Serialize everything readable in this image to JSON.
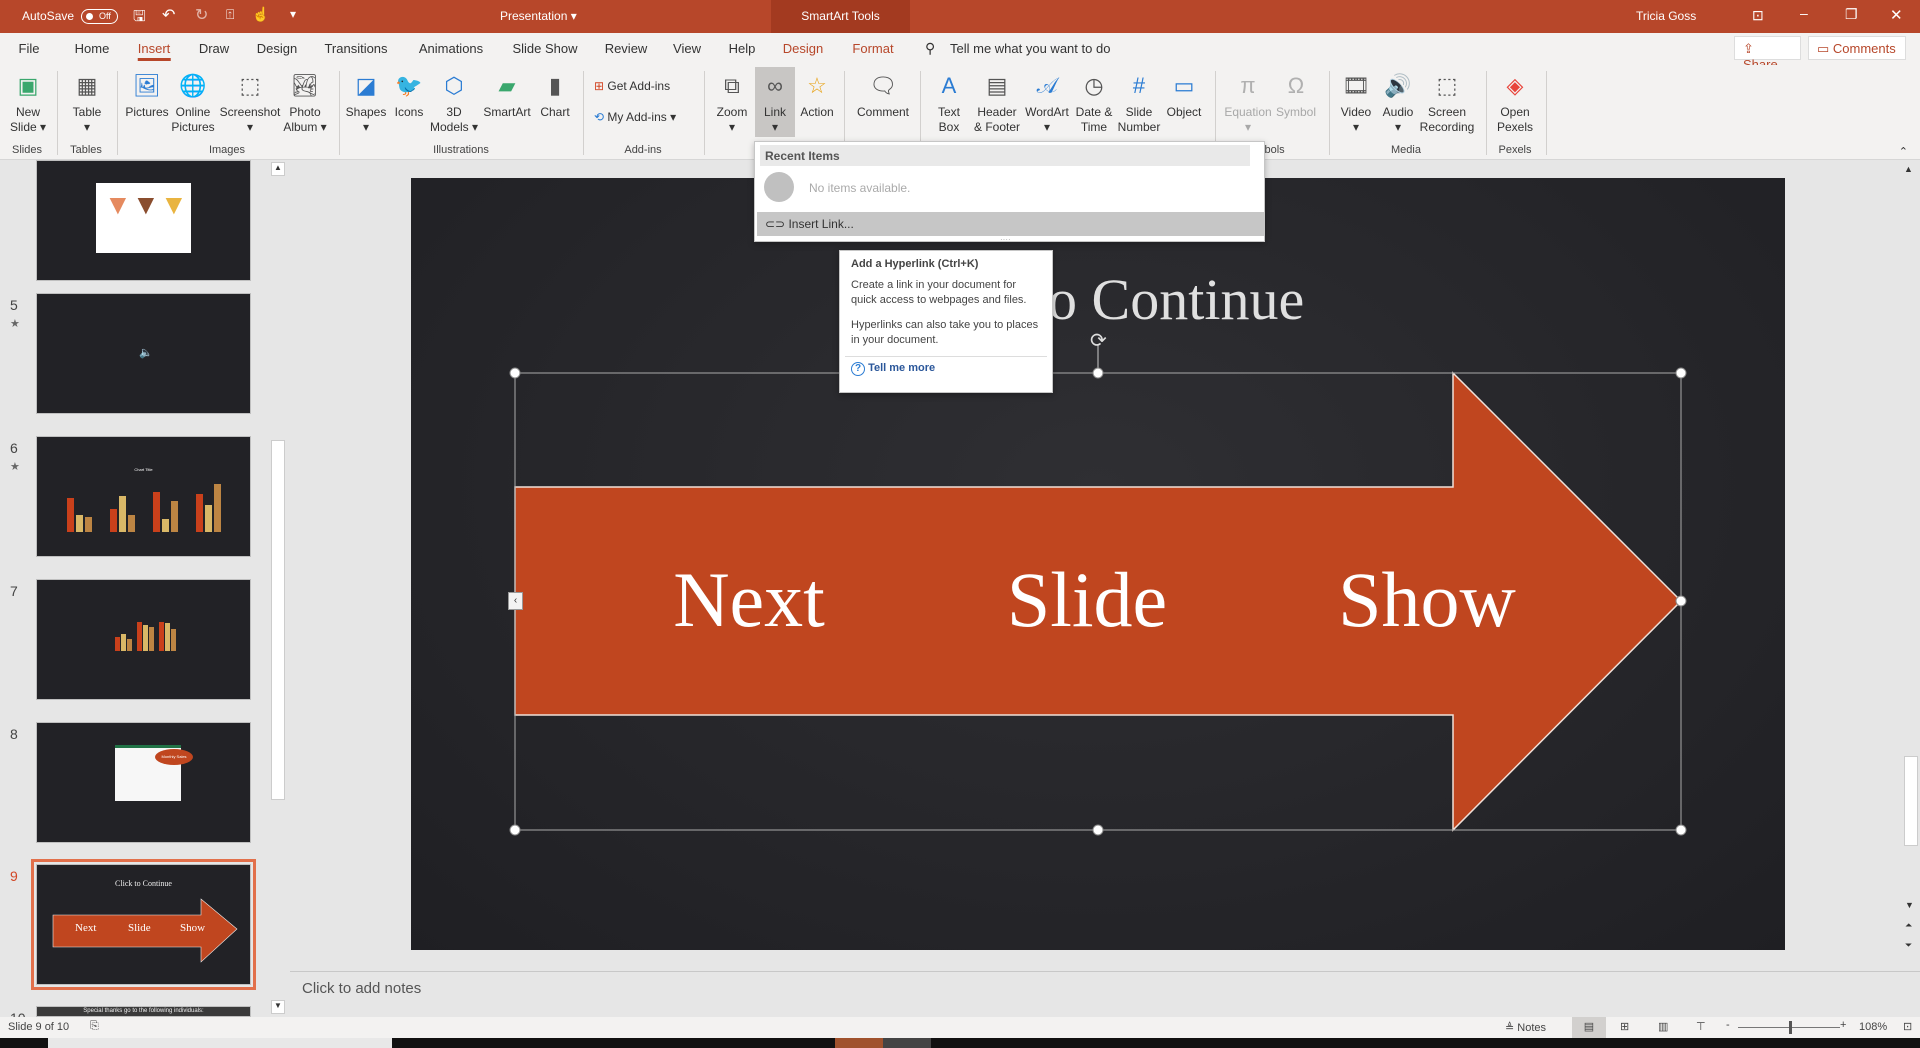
{
  "titlebar": {
    "autosave": "AutoSave",
    "autosave_state": "Off",
    "doc_title": "Presentation ▾",
    "contextual_group": "SmartArt Tools",
    "user": "Tricia Goss",
    "accent": "#b7472a"
  },
  "tabs": [
    "File",
    "Home",
    "Insert",
    "Draw",
    "Design",
    "Transitions",
    "Animations",
    "Slide Show",
    "Review",
    "View",
    "Help",
    "Design",
    "Format"
  ],
  "active_tab": "Insert",
  "search": {
    "placeholder": "Tell me what you want to do"
  },
  "share": "Share",
  "comments": "Comments",
  "ribbon": {
    "buttons": [
      {
        "label": "New\nSlide ▾",
        "icon": "new-slide-icon"
      },
      {
        "label": "Table\n▾",
        "icon": "table-icon"
      },
      {
        "label": "Pictures",
        "icon": "pictures-icon"
      },
      {
        "label": "Online\nPictures",
        "icon": "online-pictures-icon"
      },
      {
        "label": "Screenshot\n▾",
        "icon": "screenshot-icon"
      },
      {
        "label": "Photo\nAlbum ▾",
        "icon": "photo-album-icon"
      },
      {
        "label": "Shapes\n▾",
        "icon": "shapes-icon"
      },
      {
        "label": "Icons",
        "icon": "icons-icon"
      },
      {
        "label": "3D\nModels ▾",
        "icon": "3d-models-icon"
      },
      {
        "label": "SmartArt",
        "icon": "smartart-icon"
      },
      {
        "label": "Chart",
        "icon": "chart-icon"
      },
      {
        "label": "Zoom\n▾",
        "icon": "zoom-icon"
      },
      {
        "label": "Link\n▾",
        "icon": "link-icon"
      },
      {
        "label": "Action",
        "icon": "action-icon"
      },
      {
        "label": "Comment",
        "icon": "comment-icon"
      },
      {
        "label": "Text\nBox",
        "icon": "text-box-icon"
      },
      {
        "label": "Header\n& Footer",
        "icon": "header-footer-icon"
      },
      {
        "label": "WordArt\n▾",
        "icon": "wordart-icon"
      },
      {
        "label": "Date &\nTime",
        "icon": "date-time-icon"
      },
      {
        "label": "Slide\nNumber",
        "icon": "slide-number-icon"
      },
      {
        "label": "Object",
        "icon": "object-icon"
      },
      {
        "label": "Equation\n▾",
        "icon": "equation-icon",
        "disabled": true
      },
      {
        "label": "Symbol",
        "icon": "symbol-icon",
        "disabled": true
      },
      {
        "label": "Video\n▾",
        "icon": "video-icon"
      },
      {
        "label": "Audio\n▾",
        "icon": "audio-icon"
      },
      {
        "label": "Screen\nRecording",
        "icon": "screen-recording-icon"
      },
      {
        "label": "Open\nPexels",
        "icon": "pexels-icon"
      }
    ],
    "get_addins": "Get Add-ins",
    "my_addins": "My Add-ins",
    "groups": [
      "Slides",
      "Tables",
      "Images",
      "Illustrations",
      "Add-ins",
      "mbols",
      "Media",
      "Pexels"
    ]
  },
  "link_dropdown": {
    "header": "Recent Items",
    "empty": "No items available.",
    "insert_link": "Insert Link..."
  },
  "tooltip": {
    "title": "Add a Hyperlink (Ctrl+K)",
    "p1": "Create a link in your document for quick access to webpages and files.",
    "p2": "Hyperlinks can also take you to places in your document.",
    "more": "Tell me more"
  },
  "slide": {
    "title": "Click to Continue",
    "title_visible": "o Continue",
    "arrow_items": [
      "Next",
      "Slide",
      "Show"
    ],
    "arrow_color": "#c0461f"
  },
  "thumbnails": [
    {
      "num": "",
      "star": false
    },
    {
      "num": "5",
      "star": true
    },
    {
      "num": "6",
      "star": true,
      "chart_title": "Chart Title"
    },
    {
      "num": "7",
      "star": false
    },
    {
      "num": "8",
      "star": false,
      "callout": "Monthly Sales"
    },
    {
      "num": "9",
      "star": false,
      "selected": true
    },
    {
      "num": "10",
      "star": false,
      "text": "Special thanks go to the following individuals:"
    }
  ],
  "notes": {
    "placeholder": "Click to add notes"
  },
  "status": {
    "slide": "Slide 9 of 10",
    "notes": "Notes",
    "zoom": "108%",
    "zoom_percent": 108
  }
}
